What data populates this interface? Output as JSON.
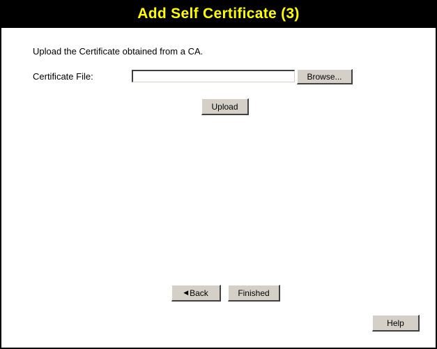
{
  "header": {
    "title": "Add Self Certificate (3)"
  },
  "form": {
    "intro": "Upload the Certificate obtained from a CA.",
    "certificate_label": "Certificate File:",
    "certificate_value": "",
    "browse_label": "Browse...",
    "upload_label": "Upload"
  },
  "footer": {
    "back_label": "Back",
    "finished_label": "Finished",
    "help_label": "Help"
  },
  "icons": {
    "back": "chevron-left-icon"
  },
  "colors": {
    "title_bg": "#000000",
    "title_text": "#ffff00",
    "button_face": "#d4d0c8"
  }
}
